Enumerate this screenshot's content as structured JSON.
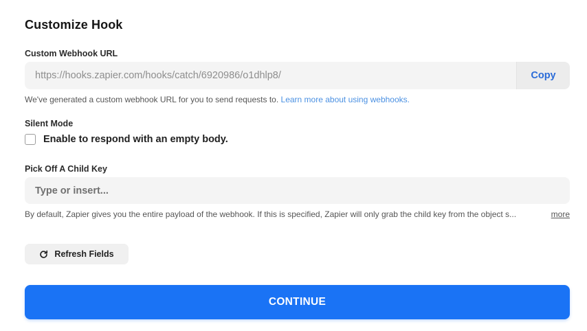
{
  "header": {
    "title": "Customize Hook"
  },
  "webhook_url": {
    "label": "Custom Webhook URL",
    "value": "https://hooks.zapier.com/hooks/catch/6920986/o1dhlp8/",
    "copy_label": "Copy",
    "help_text": "We've generated a custom webhook URL for you to send requests to.",
    "help_link": "Learn more about using webhooks."
  },
  "silent_mode": {
    "label": "Silent Mode",
    "checkbox_label": "Enable to respond with an empty body.",
    "checked": false
  },
  "child_key": {
    "label": "Pick Off A Child Key",
    "placeholder": "Type or insert...",
    "value": "",
    "help_text": "By default, Zapier gives you the entire payload of the webhook. If this is specified, Zapier will only grab the child key from the object s...",
    "more_label": "more"
  },
  "actions": {
    "refresh_label": "Refresh Fields",
    "continue_label": "CONTINUE"
  },
  "colors": {
    "accent": "#1a73f5",
    "link": "#4a90e2",
    "copy_text": "#2a6bd8"
  },
  "icons": {
    "refresh": "refresh-icon"
  }
}
